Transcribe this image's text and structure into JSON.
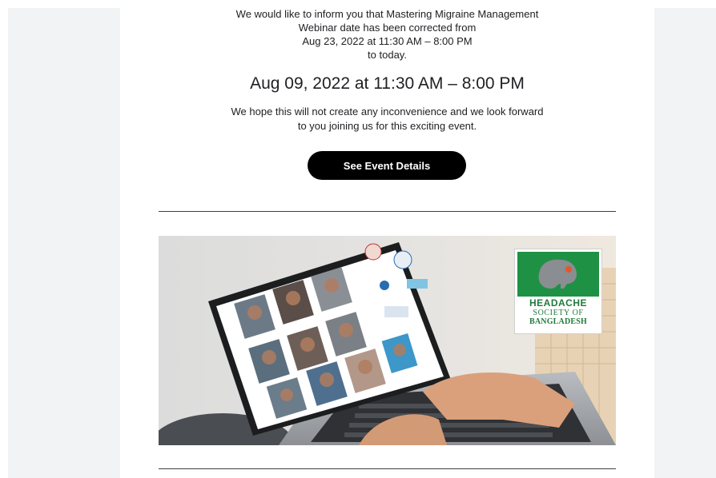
{
  "notice": {
    "line1": "We would like to inform you that Mastering Migraine Management",
    "line2": "Webinar date has been corrected from",
    "line3": "Aug 23, 2022 at 11:30 AM – 8:00 PM",
    "line4": "to today."
  },
  "new_date": "Aug 09, 2022 at 11:30 AM – 8:00 PM",
  "hope": {
    "line1": "We hope this will not create any inconvenience and we look forward",
    "line2": "to you joining us for this exciting event."
  },
  "cta_label": "See Event Details",
  "banner": {
    "logo": {
      "line1": "HEADACHE",
      "line2": "SOCIETY OF",
      "line3": "BANGLADESH"
    }
  },
  "colors": {
    "cta_bg": "#000000",
    "logo_green": "#1f9145",
    "side_gray": "#f1f3f4"
  }
}
